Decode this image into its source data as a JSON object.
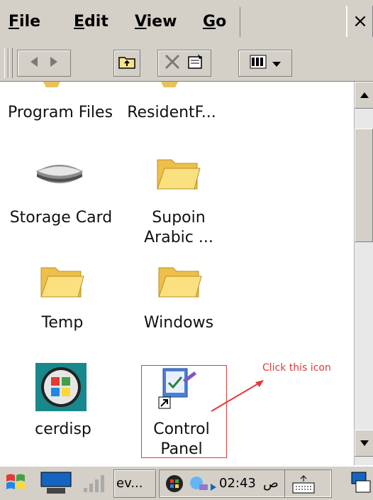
{
  "menu": {
    "file": {
      "accel": "F",
      "rest": "ile"
    },
    "edit": {
      "accel": "E",
      "rest": "dit"
    },
    "view": {
      "accel": "V",
      "rest": "iew"
    },
    "go": {
      "accel": "G",
      "rest": "o"
    },
    "close": "×"
  },
  "toolbar": {
    "buttons": [
      "back-icon",
      "forward-icon",
      "up-folder-icon",
      "delete-icon",
      "properties-icon",
      "view-list-icon"
    ]
  },
  "items": [
    {
      "label": "Program Files",
      "icon": "folder-icon"
    },
    {
      "label": "ResidentF...",
      "icon": "folder-icon"
    },
    {
      "label": "Storage Card",
      "icon": "storage-card-icon"
    },
    {
      "label_line1": "Supoin",
      "label_line2": "Arabic ...",
      "icon": "folder-icon"
    },
    {
      "label": "Temp",
      "icon": "folder-icon"
    },
    {
      "label": "Windows",
      "icon": "folder-icon"
    },
    {
      "label": "cerdisp",
      "icon": "cerdisp-icon"
    },
    {
      "label_line1": "Control",
      "label_line2": "Panel",
      "icon": "control-panel-icon"
    }
  ],
  "annotation": {
    "text": "Click this icon",
    "color": "#e53935"
  },
  "taskbar": {
    "task_label": "ev...",
    "clock": "02:43",
    "ampm": "ص"
  }
}
